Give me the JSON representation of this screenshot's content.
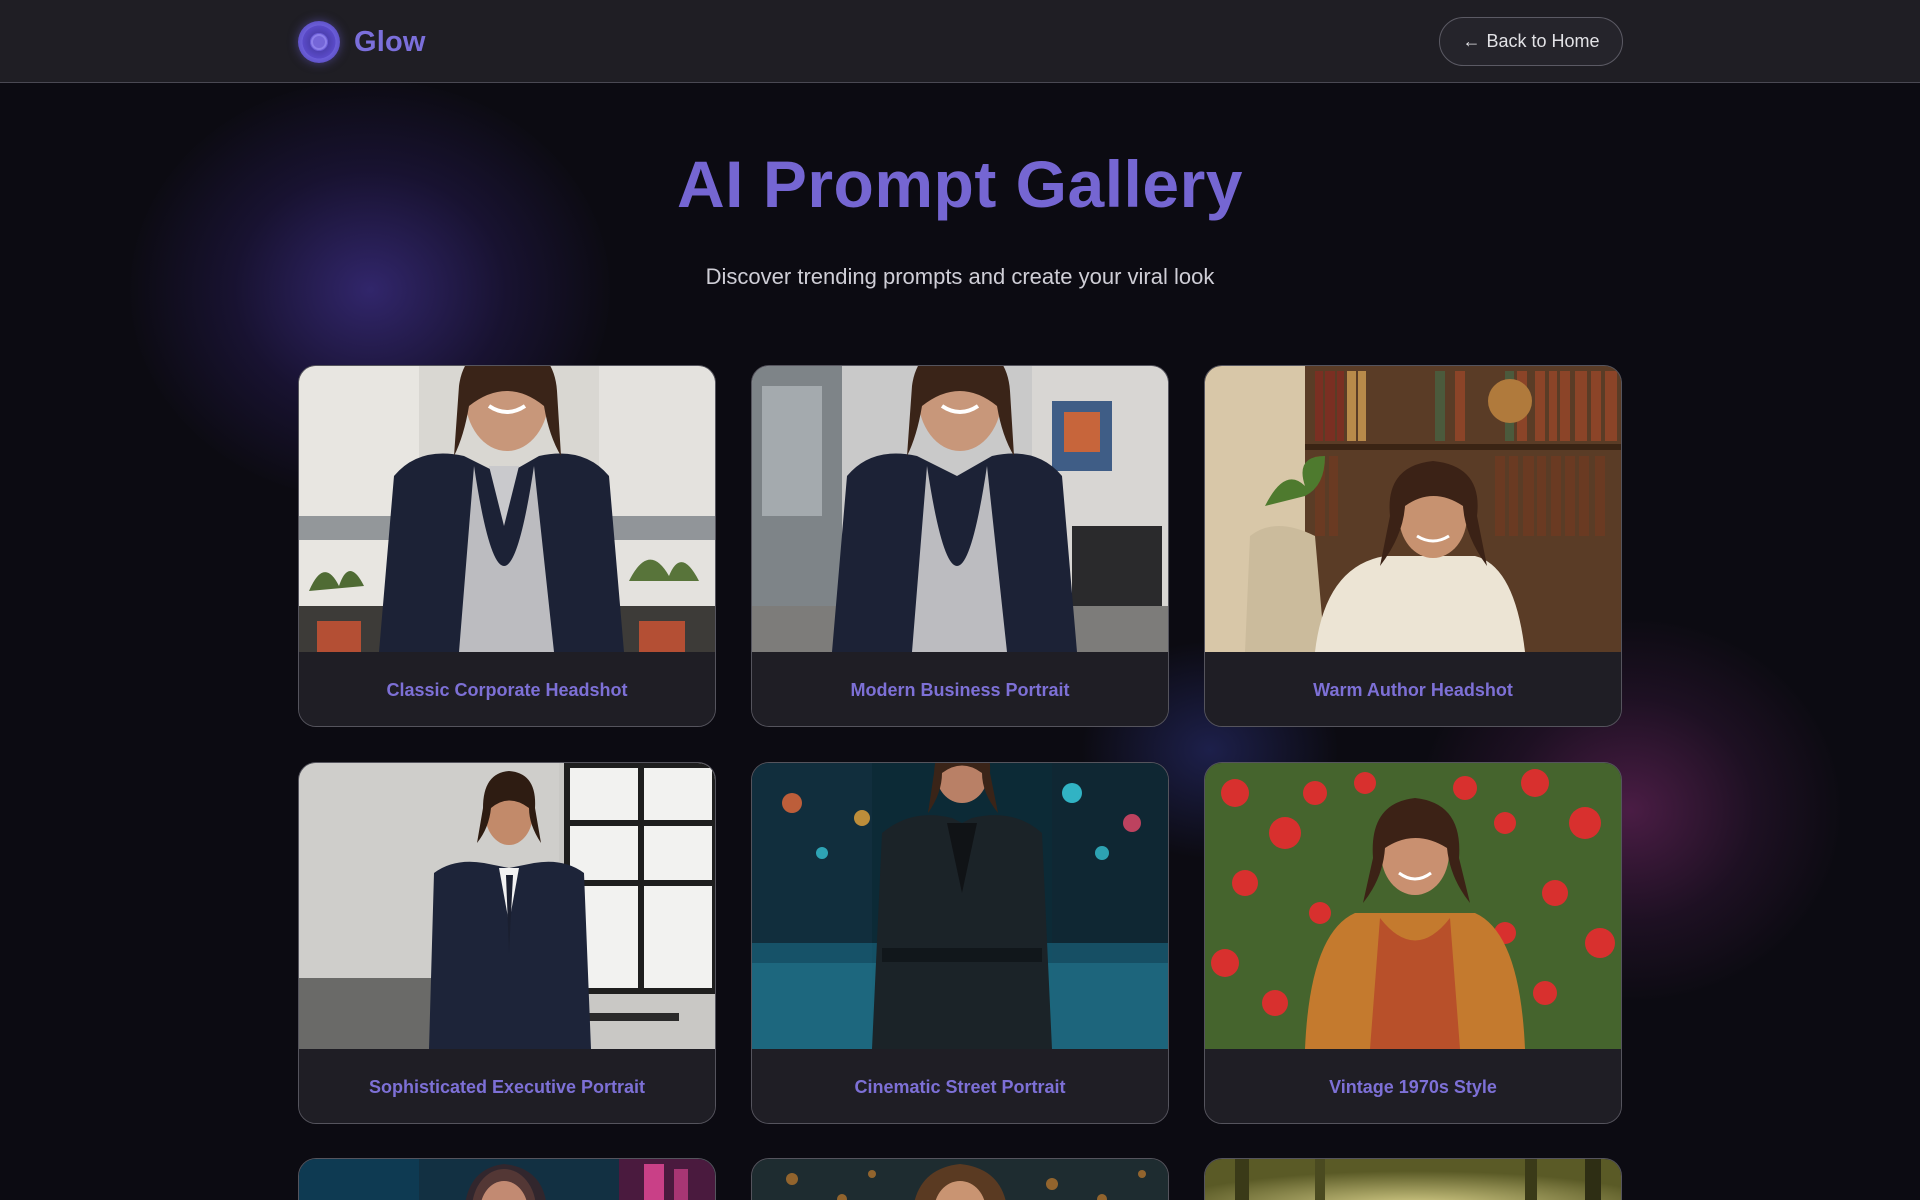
{
  "header": {
    "brand_name": "Glow",
    "back_label": "Back to Home",
    "back_arrow": "←"
  },
  "hero": {
    "title": "AI Prompt Gallery",
    "subtitle": "Discover trending prompts and create your viral look"
  },
  "gallery": {
    "cards": [
      {
        "title": "Classic Corporate Headshot"
      },
      {
        "title": "Modern Business Portrait"
      },
      {
        "title": "Warm Author Headshot"
      },
      {
        "title": "Sophisticated Executive Portrait"
      },
      {
        "title": "Cinematic Street Portrait"
      },
      {
        "title": "Vintage 1970s Style"
      }
    ]
  },
  "colors": {
    "accent": "#7566d2",
    "background": "#0c0b12",
    "header_bg": "#1f1e24",
    "card_bg": "#1f1e25"
  },
  "icons": {
    "logo": "glow-logo-icon",
    "back": "arrow-left-icon"
  }
}
